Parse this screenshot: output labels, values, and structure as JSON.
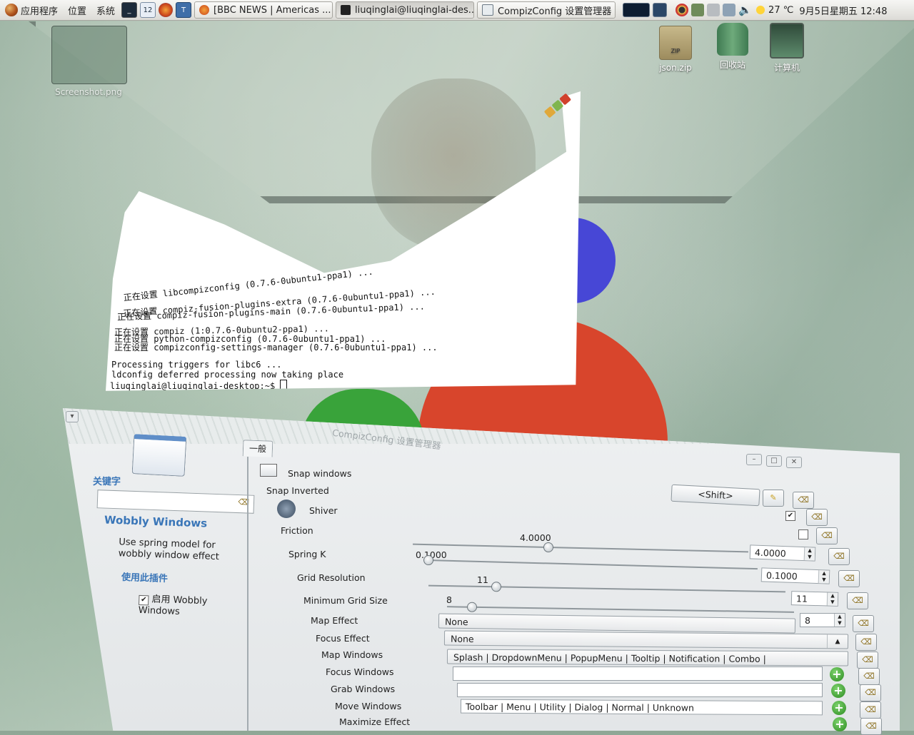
{
  "panel": {
    "menus": [
      "应用程序",
      "位置",
      "系统"
    ],
    "workspace_number": "12",
    "tasks": [
      {
        "label": "[BBC NEWS | Americas ..."
      },
      {
        "label": "liuqinglai@liuqinglai-des..."
      },
      {
        "label": "CompizConfig 设置管理器"
      }
    ],
    "weather": "27 ℃",
    "clock": "9月5日星期五 12:48"
  },
  "desktop": {
    "icons": [
      {
        "label": "Screenshot.png"
      },
      {
        "label": "json.zip",
        "badge": "ZIP"
      },
      {
        "label": "回收站"
      },
      {
        "label": "计算机"
      }
    ]
  },
  "terminal": {
    "lines": [
      "正在设置 libcompizconfig (0.7.6-0ubuntu1-ppa1) ...",
      "正在设置 compiz-fusion-plugins-extra (0.7.6-0ubuntu1-ppa1) ...",
      "正在设置 compiz-fusion-plugins-main (0.7.6-0ubuntu1-ppa1) ...",
      "正在设置 compiz (1:0.7.6-0ubuntu2-ppa1) ...",
      "正在设置 python-compizconfig (0.7.6-0ubuntu1-ppa1) ...",
      "正在设置 compizconfig-settings-manager (0.7.6-0ubuntu1-ppa1) ...",
      "Processing triggers for libc6 ...",
      "ldconfig deferred processing now taking place",
      "liuqinglai@liuqinglai-desktop:~$"
    ],
    "top_fragment": "compizconfig-s"
  },
  "ccsm": {
    "title": "CompizConfig 设置管理器",
    "sidebar": {
      "filter_heading": "关键字",
      "plugin_name": "Wobbly Windows",
      "plugin_description": "Use spring model for wobbly window effect",
      "use_plugin_heading": "使用此插件",
      "enable_label": "启用 Wobbly Windows"
    },
    "tab": "一般",
    "settings": {
      "snap_windows": "Snap windows",
      "snap_inverted": "Snap Inverted",
      "snap_inverted_value": "<Shift>",
      "shiver": "Shiver",
      "friction": "Friction",
      "friction_value": "4.0000",
      "spring_k": "Spring K",
      "spring_k_value": "0.1000",
      "grid_resolution": "Grid Resolution",
      "grid_resolution_value": "11",
      "min_grid_size": "Minimum Grid Size",
      "min_grid_size_value": "8",
      "map_effect": "Map Effect",
      "map_effect_value": "None",
      "focus_effect": "Focus Effect",
      "focus_effect_value": "None",
      "map_windows": "Map Windows",
      "map_windows_value": "Splash | DropdownMenu | PopupMenu | Tooltip | Notification | Combo |",
      "focus_windows": "Focus Windows",
      "grab_windows": "Grab Windows",
      "move_windows": "Move Windows",
      "move_windows_value": "Toolbar | Menu | Utility | Dialog | Normal | Unknown",
      "maximize_effect": "Maximize Effect"
    },
    "slider_levels": {
      "friction": 0.4,
      "spring_k": 0.0,
      "grid_resolution": 0.18,
      "min_grid_size": 0.06
    }
  }
}
